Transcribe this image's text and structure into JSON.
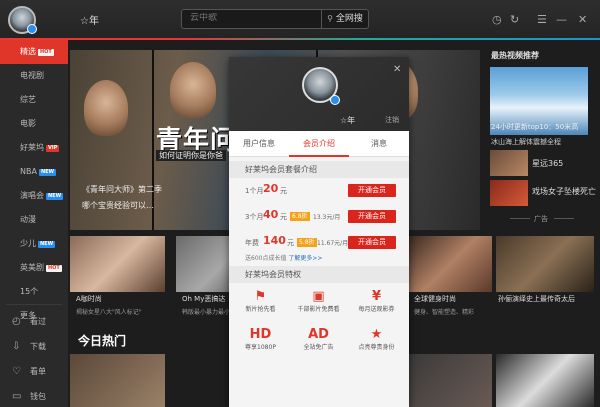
{
  "titlebar": {
    "user_name": "☆年",
    "search": {
      "placeholder": "云中歌",
      "button_label": "全网搜"
    }
  },
  "sidebar": {
    "items": [
      {
        "label": "精选",
        "badge": "HOT",
        "badge_type": "hot",
        "active": true
      },
      {
        "label": "电视剧",
        "badge": "",
        "badge_type": ""
      },
      {
        "label": "综艺",
        "badge": "",
        "badge_type": ""
      },
      {
        "label": "电影",
        "badge": "",
        "badge_type": ""
      },
      {
        "label": "好莱坞",
        "badge": "VIP",
        "badge_type": "vip"
      },
      {
        "label": "NBA",
        "badge": "NEW",
        "badge_type": "new"
      },
      {
        "label": "演唱会",
        "badge": "NEW",
        "badge_type": "new"
      },
      {
        "label": "动漫",
        "badge": "",
        "badge_type": ""
      },
      {
        "label": "少儿",
        "badge": "NEW",
        "badge_type": "new"
      },
      {
        "label": "英美剧",
        "badge": "HOT",
        "badge_type": "hot"
      },
      {
        "label": "15个",
        "badge": "",
        "badge_type": ""
      },
      {
        "label": "更多",
        "badge": "",
        "badge_type": ""
      }
    ],
    "actions": [
      {
        "label": "看过",
        "icon": "history-icon"
      },
      {
        "label": "下载",
        "icon": "download-icon"
      },
      {
        "label": "看单",
        "icon": "heart-icon"
      },
      {
        "label": "钱包",
        "icon": "wallet-icon"
      }
    ]
  },
  "main": {
    "hero": {
      "title": "青年问",
      "subtitle": "如何证明你是你爸",
      "caption": "《青年问大师》第二季",
      "caption2": "哪个宝贵经验可以…"
    },
    "right": {
      "heading": "最热视频推荐",
      "big_title": "24小时更新top10：50米高",
      "big_title2": "冰山海上解体震撼全程",
      "items": [
        "星远365",
        "戏场女子坠楼死亡",
        ""
      ],
      "ad_label": "广告"
    },
    "tiles": [
      {
        "title": "A咖时尚",
        "sub": "揭秘女星八大\"风人标记\""
      },
      {
        "title": "Oh My恶搞达",
        "sub": "韩版最小暴力最小暴"
      },
      {
        "title": "",
        "sub": ""
      },
      {
        "title": "全球健身时尚",
        "sub": "健身、智能塑造、精彩"
      },
      {
        "title": "孙俪演绎史上最传奇太后",
        "sub": ""
      }
    ],
    "section_title": "今日热门"
  },
  "popup": {
    "username": "☆年",
    "logout": "注销",
    "tabs": [
      "用户信息",
      "会员介绍",
      "消息"
    ],
    "active_tab": 1,
    "plans_header": "好莱坞会员套餐介绍",
    "plans": [
      {
        "duration": "1个月",
        "price": "20",
        "unit": "元",
        "discount": "",
        "avg": "",
        "button": "开通会员"
      },
      {
        "duration": "3个月",
        "price": "40",
        "unit": "元",
        "discount": "6.8折",
        "avg": "13.3元/月",
        "button": "开通会员"
      },
      {
        "duration": "年费",
        "price": "140",
        "unit": "元",
        "discount": "5.8折",
        "avg": "11.67元/月",
        "button": "开通会员"
      }
    ],
    "plan_note": "送600点成长值",
    "plan_note_link": "了解更多>>",
    "privileges_header": "好莱坞会员特权",
    "privileges": [
      {
        "label": "新片抢先看",
        "icon": "flag-icon"
      },
      {
        "label": "千部影片免费看",
        "icon": "film-icon"
      },
      {
        "label": "每月送观影券",
        "icon": "ticket-icon"
      },
      {
        "label": "尊享1080P",
        "icon": "hd-icon",
        "icon_text": "HD"
      },
      {
        "label": "全站免广告",
        "icon": "ad-free-icon",
        "icon_text": "AD"
      },
      {
        "label": "点亮尊贵身份",
        "icon": "star-icon"
      }
    ]
  },
  "colors": {
    "accent": "#e0362a",
    "sidebar": "#2a2a2a",
    "background": "#1c1c1c",
    "popup": "#f4f4f4",
    "badge_new": "#2a8df0"
  }
}
